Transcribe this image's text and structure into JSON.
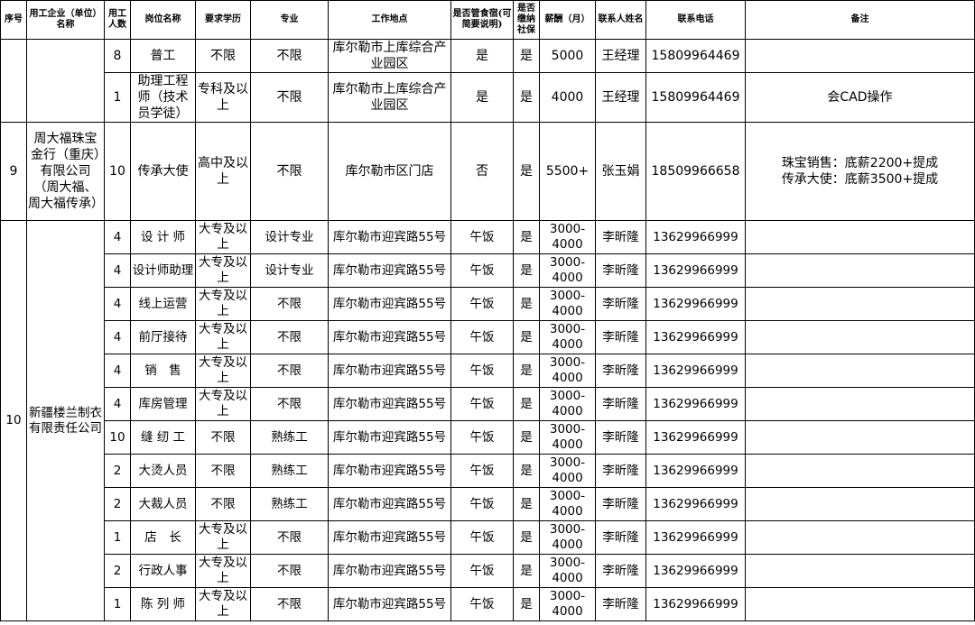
{
  "headers": [
    "序号",
    "用工企业（单位）名称",
    "用工人数",
    "岗位名称",
    "要求学历",
    "专业",
    "工作地点",
    "是否管食宿(可简要说明)",
    "是否缴纳社保",
    "薪酬（月）",
    "联系人姓名",
    "联系电话",
    "备注"
  ],
  "group8": {
    "rows": [
      {
        "count": "8",
        "position": "普工",
        "education": "不限",
        "major": "不限",
        "location": "库尔勒市上库综合产业园区",
        "board": "是",
        "insurance": "是",
        "salary": "5000",
        "contact": "王经理",
        "phone": "15809964469",
        "note": ""
      },
      {
        "count": "1",
        "position": "助理工程师（技术员学徒）",
        "education": "专科及以上",
        "major": "不限",
        "location": "库尔勒市上库综合产业园区",
        "board": "是",
        "insurance": "是",
        "salary": "4000",
        "contact": "王经理",
        "phone": "15809964469",
        "note": "会CAD操作"
      }
    ]
  },
  "group9": {
    "seq": "9",
    "company": "周大福珠宝金行（重庆）有限公司（周大福、周大福传承）",
    "row": {
      "count": "10",
      "position": "传承大使",
      "education": "高中及以上",
      "major": "不限",
      "location": "库尔勒市区门店",
      "board": "否",
      "insurance": "是",
      "salary": "5500+",
      "contact": "张玉娟",
      "phone": "18509966658",
      "note": "珠宝销售：底薪2200+提成\n传承大使：底薪3500+提成"
    }
  },
  "group10": {
    "seq": "10",
    "company": "新疆楼兰制衣有限责任公司",
    "location": "库尔勒市迎宾路55号",
    "board": "午饭",
    "insurance": "是",
    "salary": "3000-4000",
    "contact": "李昕隆",
    "phone": "13629966999",
    "rows": [
      {
        "count": "4",
        "position": "设 计 师",
        "education": "大专及以上",
        "major": "设计专业"
      },
      {
        "count": "4",
        "position": "设计师助理",
        "education": "大专及以上",
        "major": "设计专业"
      },
      {
        "count": "4",
        "position": "线上运营",
        "education": "大专及以上",
        "major": "不限"
      },
      {
        "count": "4",
        "position": "前厅接待",
        "education": "大专及以上",
        "major": "不限"
      },
      {
        "count": "4",
        "position": "销　售",
        "education": "大专及以上",
        "major": "不限"
      },
      {
        "count": "4",
        "position": "库房管理",
        "education": "大专及以上",
        "major": "不限"
      },
      {
        "count": "10",
        "position": "缝 纫 工",
        "education": "不限",
        "major": "熟练工"
      },
      {
        "count": "2",
        "position": "大烫人员",
        "education": "不限",
        "major": "熟练工"
      },
      {
        "count": "2",
        "position": "大裁人员",
        "education": "不限",
        "major": "熟练工"
      },
      {
        "count": "1",
        "position": "店　长",
        "education": "大专及以上",
        "major": "不限"
      },
      {
        "count": "2",
        "position": "行政人事",
        "education": "大专及以上",
        "major": "不限"
      },
      {
        "count": "1",
        "position": "陈 列 师",
        "education": "大专及以上",
        "major": "不限"
      }
    ]
  }
}
